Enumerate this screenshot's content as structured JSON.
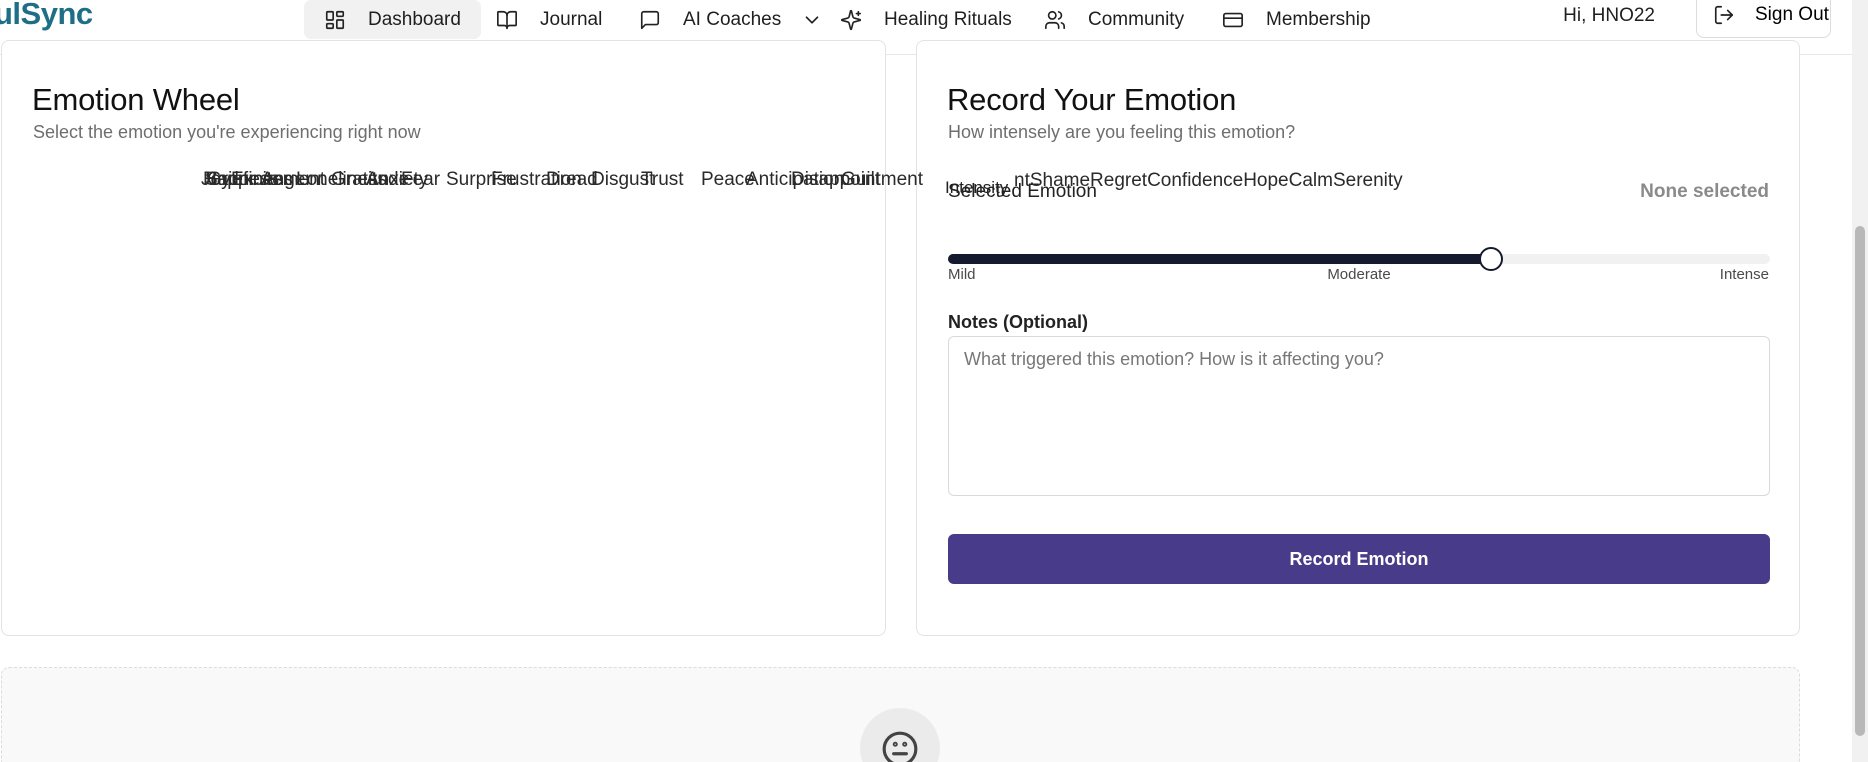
{
  "app": {
    "logo_text": "ulSync"
  },
  "nav": {
    "items": [
      {
        "label": "Dashboard",
        "icon": "grid-icon",
        "active": true
      },
      {
        "label": "Journal",
        "icon": "book-icon",
        "active": false
      },
      {
        "label": "AI Coaches",
        "icon": "chat-icon",
        "active": false,
        "has_dropdown": true
      },
      {
        "label": "Healing Rituals",
        "icon": "sparkle-icon",
        "active": false
      },
      {
        "label": "Community",
        "icon": "users-icon",
        "active": false
      },
      {
        "label": "Membership",
        "icon": "card-icon",
        "active": false
      }
    ],
    "greeting": "Hi, HNO22",
    "signout_label": "Sign Out"
  },
  "emotion_wheel": {
    "title": "Emotion Wheel",
    "subtitle": "Select the emotion you're experiencing right now",
    "overlapped_labels": [
      "Joy",
      "Happiness",
      "Sadness",
      "Grief",
      "Excitement",
      "Anger",
      "Loneliness",
      "Gratitude",
      "Anxiety",
      "Fear",
      "Surprise",
      "Frustration",
      "Dread",
      "Disgust",
      "Trust",
      "Peace",
      "Anticipation",
      "Disappointment",
      "Guilt"
    ],
    "visible_strip": "Disappointment GuiltShameRegretConfidenceHopeCalmSerenity",
    "strip_tail": "ntShameRegretConfidenceHopeCalmSerenity"
  },
  "record": {
    "title": "Record Your Emotion",
    "subtitle": "How intensely are you feeling this emotion?",
    "selected_label": "Selected Emotion",
    "selected_value": "None selected",
    "intensity_label": "Intensity",
    "intensity_value": 0.66,
    "scale": {
      "min": "Mild",
      "mid": "Moderate",
      "max": "Intense"
    },
    "notes_label": "Notes (Optional)",
    "notes_placeholder": "What triggered this emotion? How is it affecting you?",
    "notes_value": "",
    "submit_label": "Record Emotion"
  },
  "empty_state": {
    "icon": "neutral-face-icon"
  },
  "colors": {
    "brand": "#1e6f86",
    "button": "#483b8a",
    "slider": "#141b2e"
  }
}
